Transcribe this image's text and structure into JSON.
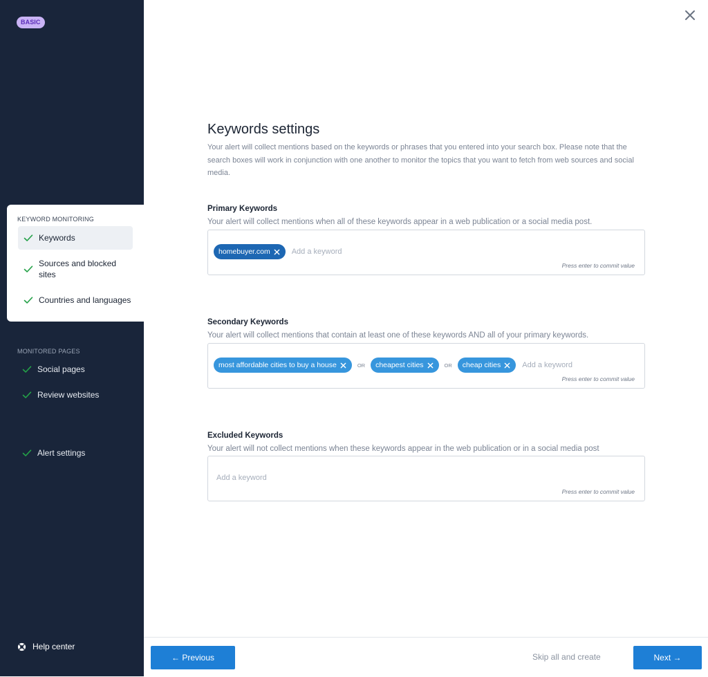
{
  "colors": {
    "sidebar_bg": "#19253a",
    "badge_bg": "#c9b3f5",
    "badge_text": "#5b2db8",
    "check_green": "#24a148",
    "primary_blue": "#1e7fd6",
    "chip_dark": "#1d67b3",
    "chip_light": "#3796dd"
  },
  "sidebar": {
    "plan_badge": "BASIC",
    "keyword_monitoring": {
      "header": "KEYWORD MONITORING",
      "items": [
        {
          "label": "Keywords",
          "icon": "check-icon",
          "active": true
        },
        {
          "label": "Sources and blocked sites",
          "icon": "check-icon",
          "active": false
        },
        {
          "label": "Countries and languages",
          "icon": "check-icon",
          "active": false
        }
      ]
    },
    "monitored_pages": {
      "header": "MONITORED PAGES",
      "items": [
        {
          "label": "Social pages",
          "icon": "check-icon"
        },
        {
          "label": "Review websites",
          "icon": "check-icon"
        }
      ]
    },
    "alert_settings": {
      "label": "Alert settings",
      "icon": "check-icon"
    },
    "help_center": {
      "label": "Help center",
      "icon": "lifebuoy-icon"
    }
  },
  "header": {
    "close_icon": "close-icon"
  },
  "main": {
    "title": "Keywords settings",
    "description": "Your alert will collect mentions based on the keywords or phrases that you entered into your search box. Please note that the search boxes will work in conjunction with one another to monitor the topics that you want to fetch from web sources and social media.",
    "primary": {
      "title": "Primary Keywords",
      "description": "Your alert will collect mentions when all of these keywords appear in a web publication or a social media post.",
      "chips": [
        "homebuyer.com"
      ],
      "placeholder": "Add a keyword",
      "hint": "Press enter to commit value"
    },
    "secondary": {
      "title": "Secondary Keywords",
      "description": "Your alert will collect mentions that contain at least one of these keywords AND all of your primary keywords.",
      "chips": [
        "most affordable cities to buy a house",
        "cheapest cities",
        "cheap cities"
      ],
      "separator": "OR",
      "placeholder": "Add a keyword",
      "hint": "Press enter to commit value"
    },
    "excluded": {
      "title": "Excluded Keywords",
      "description": "Your alert will not collect mentions when these keywords appear in the web publication or in a social media post",
      "placeholder": "Add a keyword",
      "hint": "Press enter to commit value"
    }
  },
  "footer": {
    "previous_label": "← Previous",
    "skip_label": "Skip all and create",
    "next_label": "Next →"
  }
}
